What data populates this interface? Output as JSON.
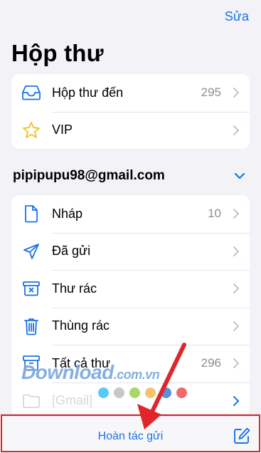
{
  "header": {
    "edit_label": "Sửa",
    "title": "Hộp thư"
  },
  "mailboxes": [
    {
      "label": "Hộp thư đến",
      "count": "295",
      "icon": "inbox-icon"
    },
    {
      "label": "VIP",
      "count": "",
      "icon": "star-icon"
    }
  ],
  "account": {
    "email": "pipipupu98@gmail.com",
    "folders": [
      {
        "label": "Nháp",
        "count": "10",
        "icon": "draft-icon"
      },
      {
        "label": "Đã gửi",
        "count": "",
        "icon": "paper-plane-icon"
      },
      {
        "label": "Thư rác",
        "count": "",
        "icon": "junk-icon"
      },
      {
        "label": "Thùng rác",
        "count": "",
        "icon": "trash-icon"
      },
      {
        "label": "Tất cả thư",
        "count": "296",
        "icon": "archive-icon"
      },
      {
        "label": "[Gmail]",
        "count": "",
        "icon": "folder-icon"
      }
    ]
  },
  "toolbar": {
    "undo_send_label": "Hoàn tác gửi",
    "compose_icon": "compose-icon"
  },
  "watermark": {
    "text": "Download",
    "suffix": ".com.vn",
    "dot_colors": [
      "#5ac8fa",
      "#c7c7cc",
      "#a8d86a",
      "#f7c46a",
      "#5b8fd9",
      "#f06a6a"
    ]
  },
  "colors": {
    "accent": "#1a73e8",
    "annotation": "#e0262a"
  }
}
